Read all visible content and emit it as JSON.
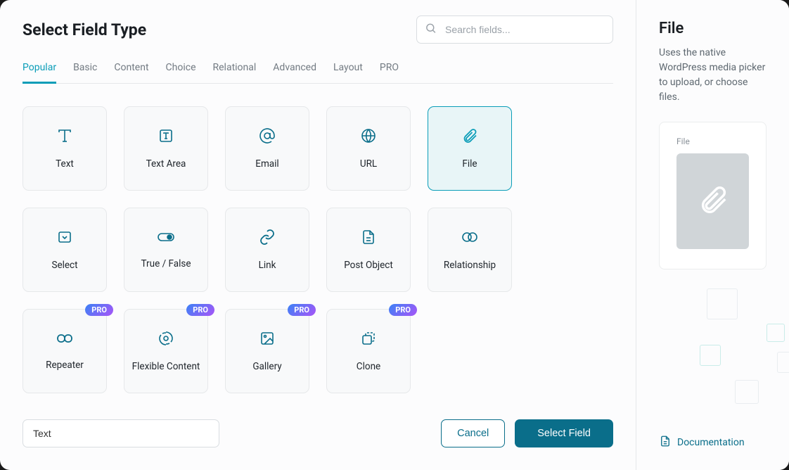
{
  "title": "Select Field Type",
  "search": {
    "placeholder": "Search fields..."
  },
  "tabs": [
    {
      "label": "Popular",
      "active": true
    },
    {
      "label": "Basic"
    },
    {
      "label": "Content"
    },
    {
      "label": "Choice"
    },
    {
      "label": "Relational"
    },
    {
      "label": "Advanced"
    },
    {
      "label": "Layout"
    },
    {
      "label": "PRO"
    }
  ],
  "fields": [
    {
      "label": "Text",
      "icon": "text",
      "pro": false
    },
    {
      "label": "Text Area",
      "icon": "textarea",
      "pro": false
    },
    {
      "label": "Email",
      "icon": "email",
      "pro": false
    },
    {
      "label": "URL",
      "icon": "url",
      "pro": false
    },
    {
      "label": "File",
      "icon": "file",
      "pro": false,
      "selected": true
    },
    {
      "label": "Select",
      "icon": "select",
      "pro": false
    },
    {
      "label": "True / False",
      "icon": "truefalse",
      "pro": false
    },
    {
      "label": "Link",
      "icon": "link",
      "pro": false
    },
    {
      "label": "Post Object",
      "icon": "postobject",
      "pro": false
    },
    {
      "label": "Relationship",
      "icon": "relationship",
      "pro": false
    },
    {
      "label": "Repeater",
      "icon": "repeater",
      "pro": true
    },
    {
      "label": "Flexible Content",
      "icon": "flexible",
      "pro": true
    },
    {
      "label": "Gallery",
      "icon": "gallery",
      "pro": true
    },
    {
      "label": "Clone",
      "icon": "clone",
      "pro": true
    }
  ],
  "pro_label": "PRO",
  "filter_value": "Text",
  "buttons": {
    "cancel": "Cancel",
    "select": "Select Field"
  },
  "side": {
    "title": "File",
    "description": "Uses the native WordPress media picker to upload, or choose files.",
    "preview_label": "File",
    "doc_link": "Documentation"
  }
}
